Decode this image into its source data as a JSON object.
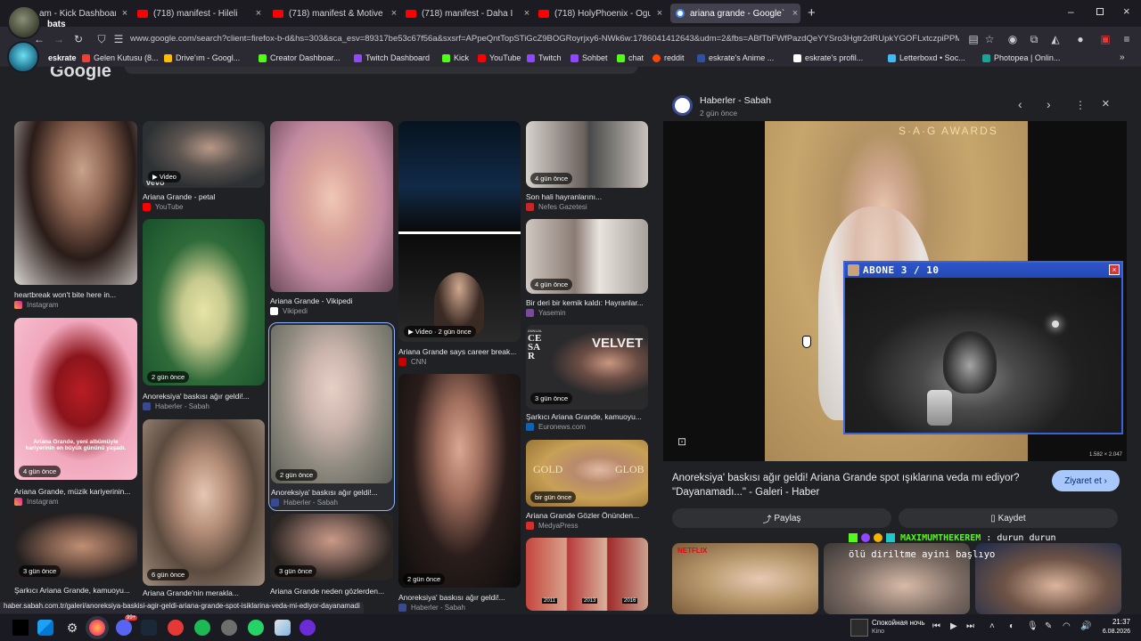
{
  "tabs": [
    {
      "title": "am - Kick Dashboard",
      "color": "#53fc18"
    },
    {
      "title": "(718) manifest - Hileli",
      "color": "#ff0000"
    },
    {
      "title": "(718) manifest & Motive",
      "color": "#ff0000"
    },
    {
      "title": "(718) manifest - Daha İ",
      "color": "#ff0000"
    },
    {
      "title": "(718) HolyPhoenix - Ogu",
      "color": "#ff0000"
    },
    {
      "title": "ariana grande - Google`",
      "color": "#4285f4"
    }
  ],
  "stream_overlay": {
    "top_user": "bats",
    "second_user": "eskrate"
  },
  "nav": {
    "url": "www.google.com/search?client=firefox-b-d&hs=303&sca_esv=89317be53c67f56a&sxsrf=APpeQntTopSTiGcZ9BOGRoyrjxy6-NWk6w:1786041412643&udm=2&fbs=ABfTbFWfPazdQeYYSro3Hgtr2dRUpkYGOFLxtczpiPPMonK6b0at"
  },
  "bookmarks": [
    {
      "label": "Gelen Kutusu (8...",
      "color": "#ea4335"
    },
    {
      "label": "Drive'ım - Googl...",
      "color": "#fbbc04"
    },
    {
      "label": "Creator Dashboar...",
      "color": "#53fc18"
    },
    {
      "label": "Twitch Dashboard",
      "color": "#9146ff"
    },
    {
      "label": "Kick",
      "color": "#53fc18"
    },
    {
      "label": "YouTube",
      "color": "#ff0000"
    },
    {
      "label": "Twitch",
      "color": "#9146ff"
    },
    {
      "label": "Sohbet",
      "color": "#9146ff"
    },
    {
      "label": "chat",
      "color": "#53fc18"
    },
    {
      "label": "reddit",
      "color": "#ff4500"
    },
    {
      "label": "eskrate's Anime ...",
      "color": "#2e51a2"
    },
    {
      "label": "eskrate's profil...",
      "color": "#ffffff"
    },
    {
      "label": "Letterboxd • Soc...",
      "color": "#40bcf4"
    },
    {
      "label": "Photopea | Onlin...",
      "color": "#18a497"
    }
  ],
  "results": [
    {
      "caption": "heartbreak won't bite here in...",
      "source": "Instagram",
      "badge": ""
    },
    {
      "caption": "Ariana Grande - petal",
      "source": "YouTube",
      "badge": "Video"
    },
    {
      "caption": "Ariana Grande - Vikipedi",
      "source": "Vikipedi",
      "badge": ""
    },
    {
      "caption": "Ariana Grande says career break...",
      "source": "CNN",
      "badge": "Video · 2 gün önce"
    },
    {
      "caption": "Son hali hayranlarını...",
      "source": "Nefes Gazetesi",
      "badge": "4 gün önce"
    },
    {
      "caption": "Anoreksiya' baskısı ağır geldi!...",
      "source": "Haberler - Sabah",
      "badge": "2 gün önce"
    },
    {
      "caption": "Anoreksiya' baskısı ağır geldi!...",
      "source": "Haberler - Sabah",
      "badge": "2 gün önce"
    },
    {
      "caption": "Bir deri bir kemik kaldı: Hayranlar...",
      "source": "Yasemin",
      "badge": "4 gün önce"
    },
    {
      "caption": "Ariana Grande, müzik kariyerinin...",
      "source": "Instagram",
      "badge": "4 gün önce"
    },
    {
      "caption": "Şarkıcı Ariana Grande, kamuoyu...",
      "source": "Euronews.com",
      "badge": "3 gün önce"
    },
    {
      "caption": "Ariana Grande Gözler Önünden...",
      "source": "MedyaPress",
      "badge": "bir gün önce"
    },
    {
      "caption": "Şarkıcı Ariana Grande, kamuoyu...",
      "source": "",
      "badge": "3 gün önce"
    },
    {
      "caption": "Ariana Grande'nin merakla...",
      "source": "",
      "badge": "6 gün önce"
    },
    {
      "caption": "Ariana Grande neden gözlerden...",
      "source": "",
      "badge": "3 gün önce"
    },
    {
      "caption": "Anoreksiya' baskısı ağır geldi!...",
      "source": "Haberler - Sabah",
      "badge": "2 gün önce"
    }
  ],
  "thumb_texts": {
    "vevo": "vevo",
    "pink_overlay_1": "Ariana Grande, yeni albümüyle",
    "pink_overlay_2": "kariyerinin en büyük gününü yaşadı.",
    "cesar_c": "C",
    "cesar_e": "E",
    "cesar_s": "S",
    "cesar_a": "A",
    "cesar_r": "R",
    "cesar_annual": "ANNUAL",
    "yellow_brand": "VELVET",
    "golden": "GOLD",
    "glob": "GLOB",
    "year1": "2011",
    "year2": "2013",
    "year3": "2016",
    "netflix": "NETFLIX"
  },
  "panel": {
    "source_name": "Haberler - Sabah",
    "time": "2 gün önce",
    "dimensions": "1.582 × 2.047",
    "title_line1": "Anoreksiya' baskısı ağır geldi! Ariana Grande spot ışıklarına veda mı ediyor?",
    "title_line2": "\"Dayanamadı...\" - Galeri - Haber",
    "visit_label": "Ziyaret et",
    "share_label": "Paylaş",
    "save_label": "Kaydet",
    "photo_text": "S·A·G AWARDS"
  },
  "webcam": {
    "title": "ABONE 3 / 10"
  },
  "chat_overlay": {
    "username": "MAXIMUMTHEKEREM",
    "message": ": durun durun",
    "line2": "ölü diriltme ayini başlıyo"
  },
  "status_url": "haber.sabah.com.tr/galeri/anoreksiya-baskisi-agir-geldi-ariana-grande-spot-isiklarina-veda-mi-ediyor-dayanamadi",
  "taskbar": {
    "media_title": "Спокойная ночь",
    "media_artist": "Kino",
    "time": "21:37",
    "date": "6.08.2026",
    "badge_count": "99+"
  }
}
